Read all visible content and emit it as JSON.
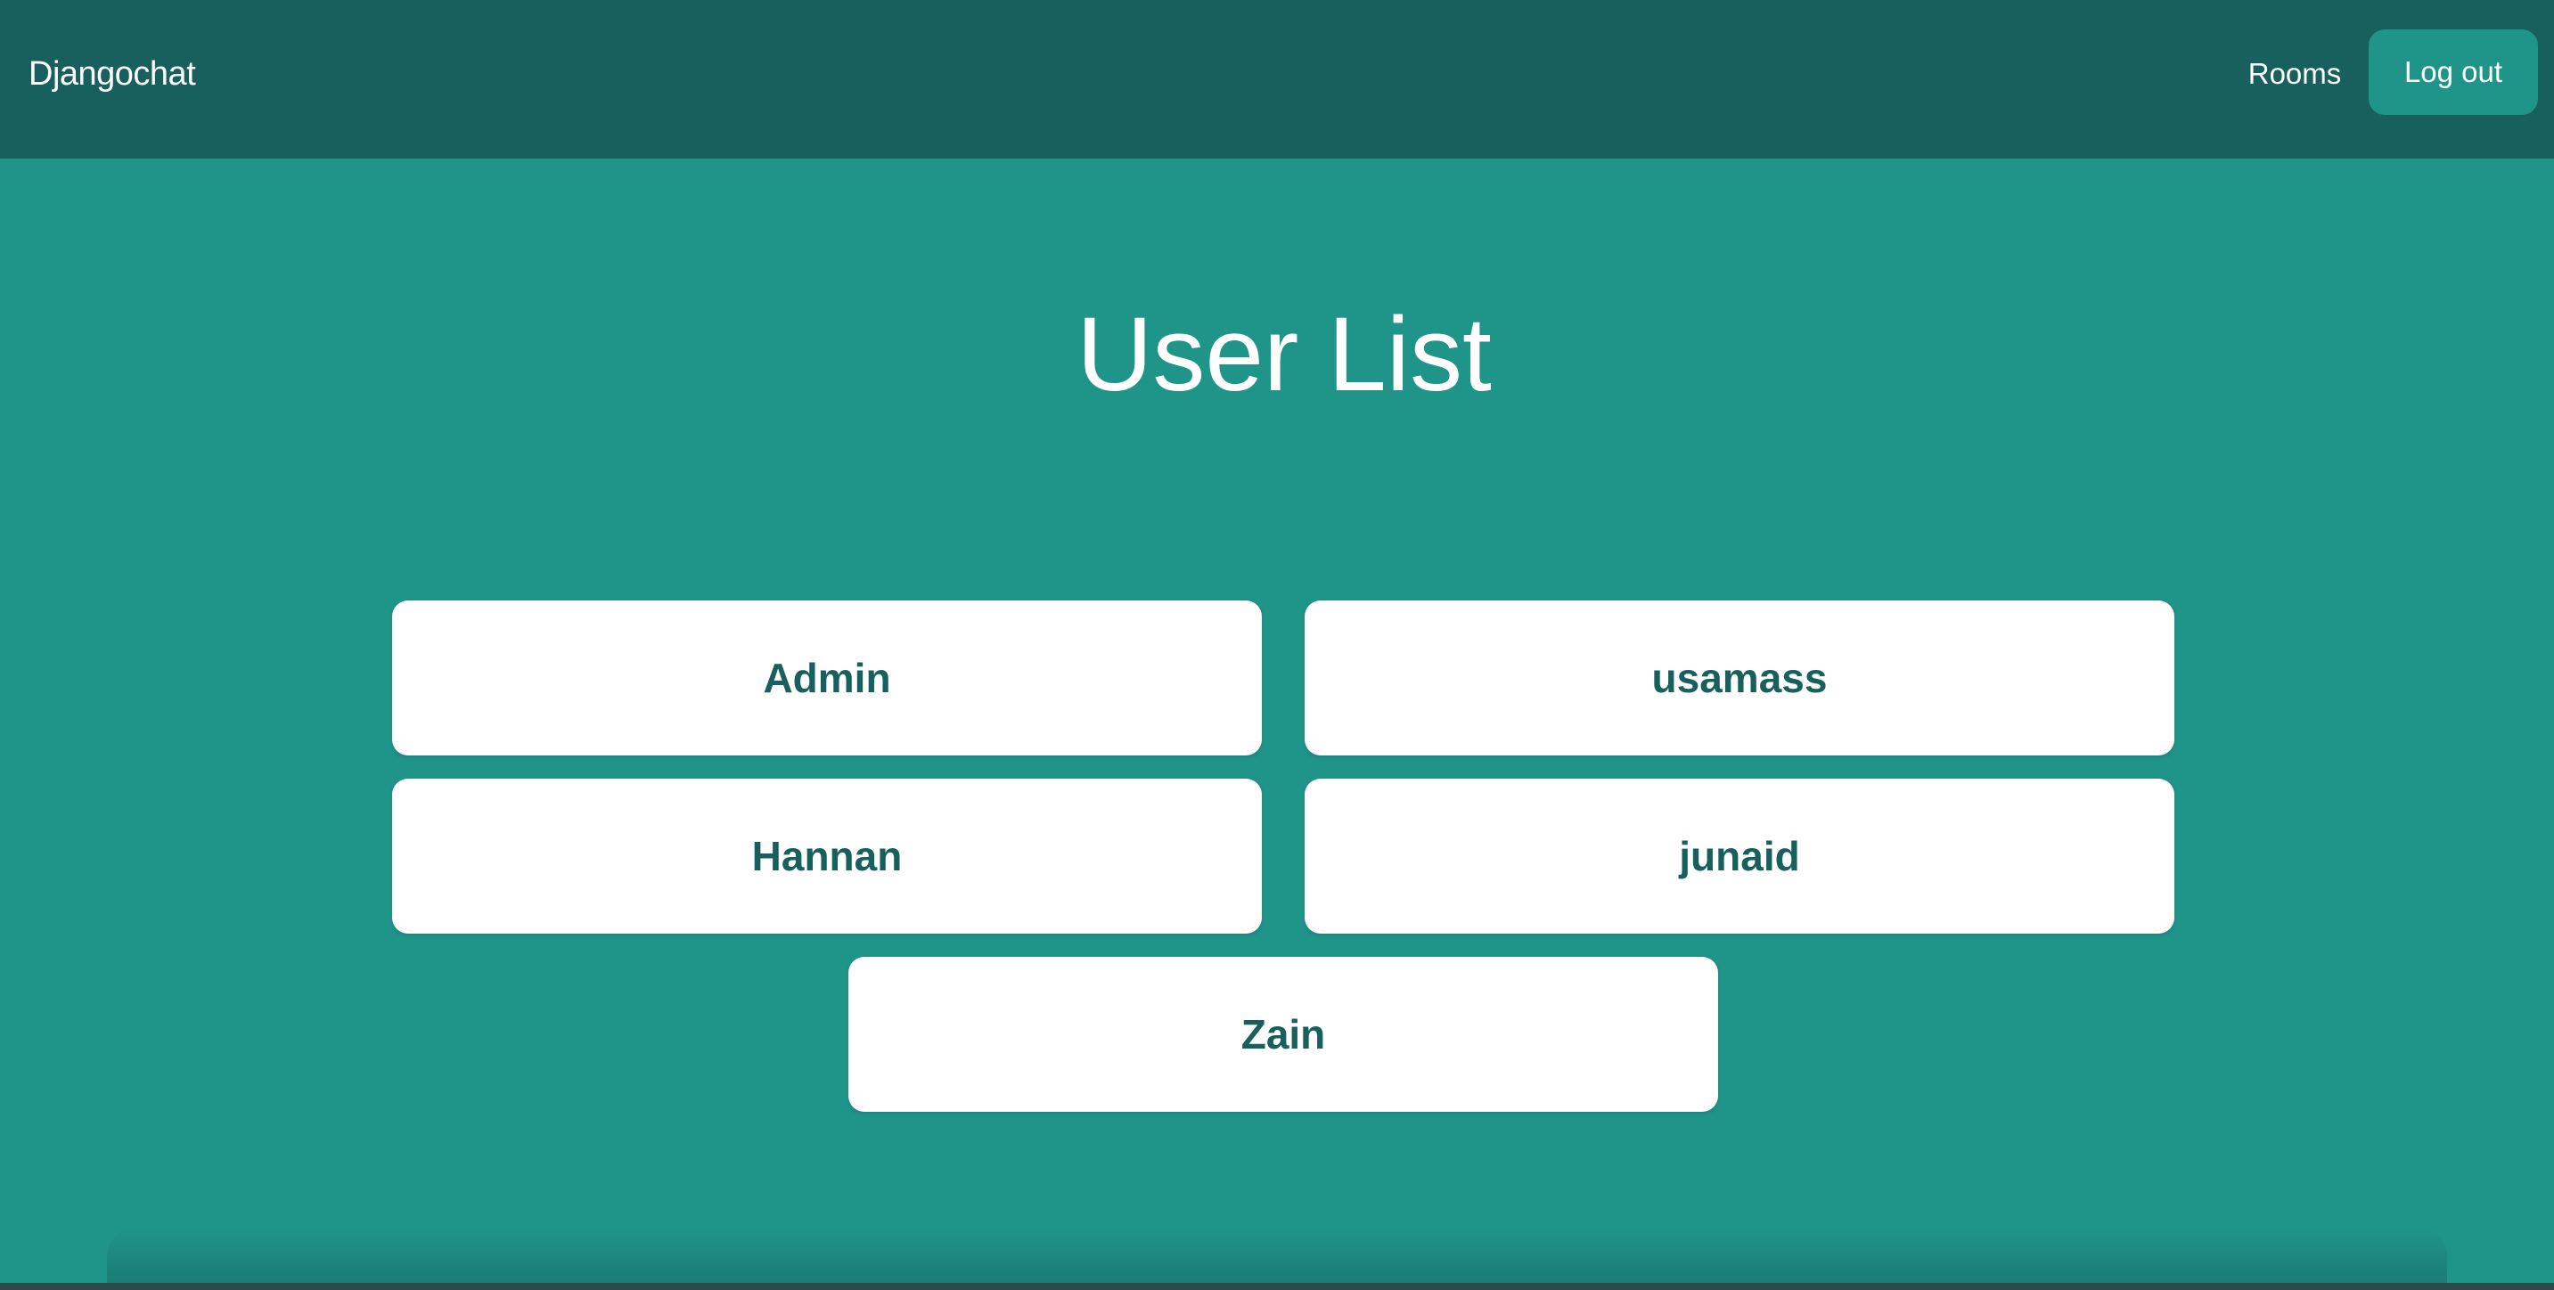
{
  "nav": {
    "brand": "Djangochat",
    "rooms_label": "Rooms",
    "logout_label": "Log out"
  },
  "main": {
    "title": "User List",
    "users": [
      "Admin",
      "usamass",
      "Hannan",
      "junaid",
      "Zain"
    ]
  },
  "colors": {
    "nav_background": "#17605d",
    "page_background": "#1f9488",
    "card_background": "#ffffff",
    "card_text": "#17605d"
  }
}
